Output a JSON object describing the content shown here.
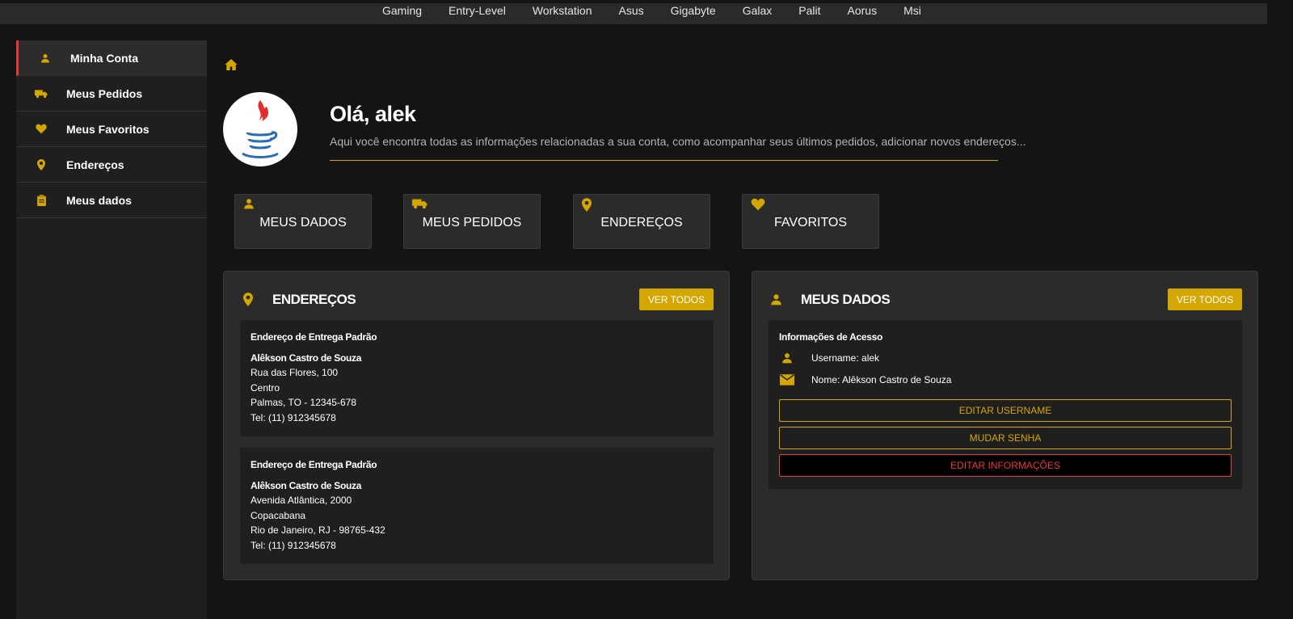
{
  "topnav": [
    "Gaming",
    "Entry-Level",
    "Workstation",
    "Asus",
    "Gigabyte",
    "Galax",
    "Palit",
    "Aorus",
    "Msi"
  ],
  "sidebar": {
    "items": [
      {
        "label": "Minha Conta",
        "icon": "user-icon"
      },
      {
        "label": "Meus Pedidos",
        "icon": "truck-icon"
      },
      {
        "label": "Meus Favoritos",
        "icon": "heart-icon"
      },
      {
        "label": "Endereços",
        "icon": "location-pin-icon"
      },
      {
        "label": "Meus dados",
        "icon": "clipboard-icon"
      }
    ]
  },
  "header": {
    "greeting": "Olá, alek",
    "subtitle": "Aqui você encontra todas as informações relacionadas a sua conta, como acompanhar seus últimos pedidos, adicionar novos endereços..."
  },
  "tiles": [
    {
      "label": "MEUS DADOS",
      "icon": "user-icon"
    },
    {
      "label": "MEUS PEDIDOS",
      "icon": "truck-icon"
    },
    {
      "label": "ENDEREÇOS",
      "icon": "location-pin-icon"
    },
    {
      "label": "FAVORITOS",
      "icon": "heart-icon"
    }
  ],
  "addresses_card": {
    "title": "ENDEREÇOS",
    "button": "VER TODOS",
    "addresses": [
      {
        "heading": "Endereço de Entrega Padrão",
        "name": "Alêkson Castro de Souza",
        "street": "Rua das Flores, 100",
        "district": "Centro",
        "city": "Palmas, TO - 12345-678",
        "phone": "Tel: (11) 912345678"
      },
      {
        "heading": "Endereço de Entrega Padrão",
        "name": "Alêkson Castro de Souza",
        "street": "Avenida Atlântica, 2000",
        "district": "Copacabana",
        "city": "Rio de Janeiro, RJ - 98765-432",
        "phone": "Tel: (11) 912345678"
      }
    ]
  },
  "data_card": {
    "title": "MEUS DADOS",
    "button": "VER TODOS",
    "section_title": "Informações de Acesso",
    "username": "Username: alek",
    "name": "Nome: Alêkson Castro de Souza",
    "edit_username": "EDITAR USERNAME",
    "change_password": "MUDAR SENHA",
    "edit_info": "EDITAR INFORMAÇÕES"
  },
  "colors": {
    "accent": "#d4a600",
    "danger": "#e53935",
    "background": "#141414",
    "card": "#2b2b2b"
  }
}
